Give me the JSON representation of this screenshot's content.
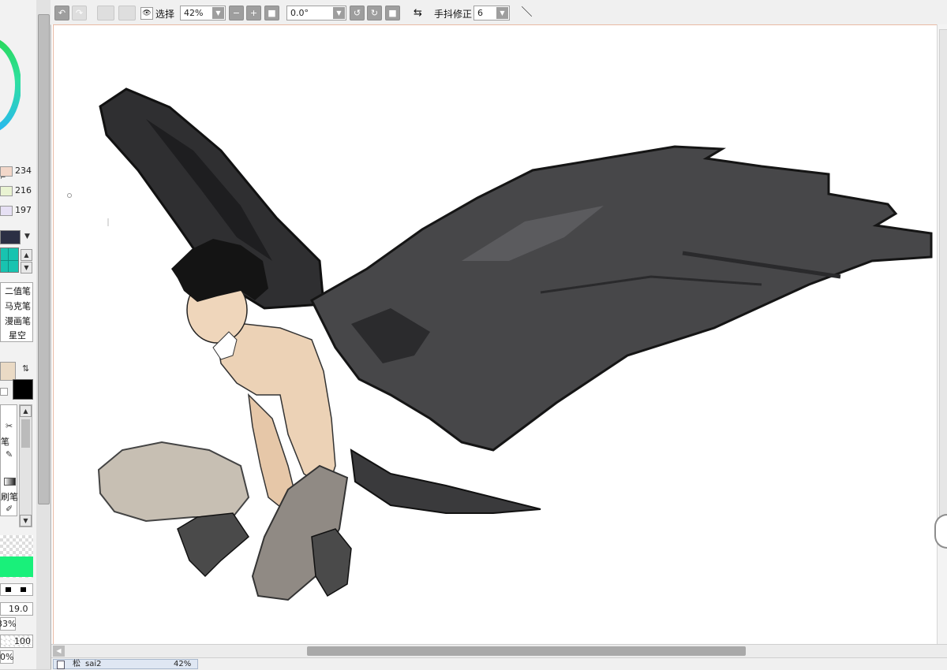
{
  "colors": {
    "panel_bg": "#f2f2f2",
    "toolbar_bg": "#f0f0f0",
    "button_gray": "#9e9e9e",
    "canvas_border": "#e8b9a3",
    "brush_green": "#19f07a",
    "primary_color": "#000000",
    "secondary_color": "#eadac5"
  },
  "toolbar": {
    "undo_icon": "undo-icon",
    "selection_label": "选择",
    "zoom_value": "42%",
    "rotation_value": "0.0°",
    "stabilizer_label": "手抖修正",
    "stabilizer_value": "6"
  },
  "color_panel": {
    "values": [
      "234",
      "216",
      "197"
    ]
  },
  "brush_tools": [
    "二值笔",
    "马克笔",
    "漫画笔",
    "星空"
  ],
  "tool_list": {
    "partial_labels": [
      "笔",
      "刷笔"
    ]
  },
  "brush_settings": {
    "size_value": "19.0",
    "min_size_value": "33%",
    "density_value": "100",
    "last_value": "0%"
  },
  "statusbar": {
    "file_name": "sai2",
    "file_prefix": "松",
    "file_zoom": "42%"
  }
}
